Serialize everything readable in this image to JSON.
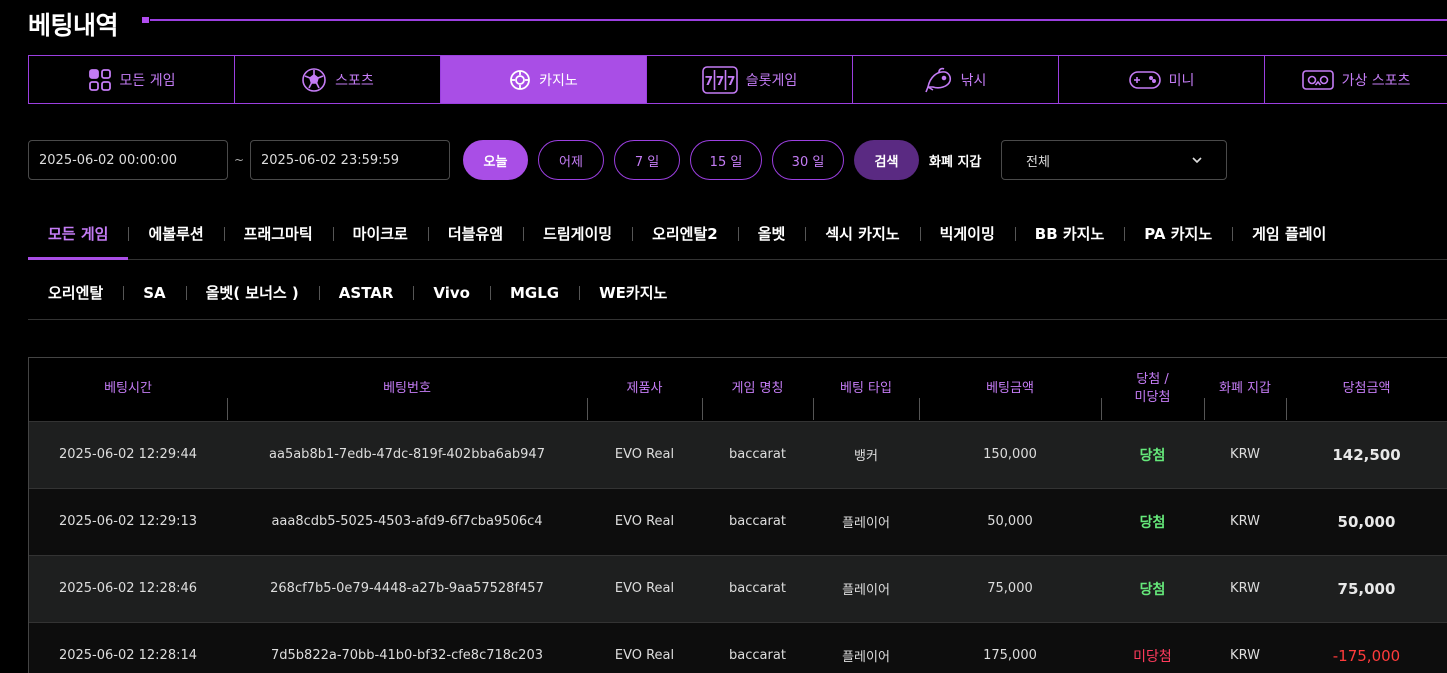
{
  "page": {
    "title": "베팅내역"
  },
  "categories": [
    {
      "label": "모든 게임",
      "icon": "grid-icon",
      "active": false
    },
    {
      "label": "스포츠",
      "icon": "soccer-ball-icon",
      "active": false
    },
    {
      "label": "카지노",
      "icon": "casino-chip-icon",
      "active": true
    },
    {
      "label": "슬롯게임",
      "icon": "slot-777-icon",
      "active": false
    },
    {
      "label": "낚시",
      "icon": "fish-icon",
      "active": false
    },
    {
      "label": "미니",
      "icon": "gamepad-icon",
      "active": false
    },
    {
      "label": "가상 스포츠",
      "icon": "vr-headset-icon",
      "active": false
    }
  ],
  "filter": {
    "start_date": "2025-06-02 00:00:00",
    "separator": "~",
    "end_date": "2025-06-02 23:59:59",
    "quick": [
      "오늘",
      "어제",
      "7 일",
      "15 일",
      "30 일"
    ],
    "active_quick": "오늘",
    "search_label": "검색",
    "wallet_label": "화폐 지갑",
    "wallet_value": "전체"
  },
  "providers_row1": [
    "모든 게임",
    "에볼루션",
    "프래그마틱",
    "마이크로",
    "더블유엠",
    "드림게이밍",
    "오리엔탈2",
    "올벳",
    "섹시 카지노",
    "빅게이밍",
    "BB 카지노",
    "PA 카지노",
    "게임 플레이"
  ],
  "providers_row2": [
    "오리엔탈",
    "SA",
    "올벳( 보너스 )",
    "ASTAR",
    "Vivo",
    "MGLG",
    "WE카지노"
  ],
  "active_provider": "모든 게임",
  "table": {
    "headers": [
      "베팅시간",
      "베팅번호",
      "제품사",
      "게임 명칭",
      "베팅 타입",
      "베팅금액",
      "당첨 /\n미당첨",
      "화폐 지갑",
      "당첨금액"
    ],
    "rows": [
      {
        "time": "2025-06-02 12:29:44",
        "bet_id": "aa5ab8b1-7edb-47dc-819f-402bba6ab947",
        "vendor": "EVO Real",
        "game": "baccarat",
        "type": "뱅커",
        "amount": "150,000",
        "result": "당첨",
        "win": true,
        "wallet": "KRW",
        "payout": "142,500"
      },
      {
        "time": "2025-06-02 12:29:13",
        "bet_id": "aaa8cdb5-5025-4503-afd9-6f7cba9506c4",
        "vendor": "EVO Real",
        "game": "baccarat",
        "type": "플레이어",
        "amount": "50,000",
        "result": "당첨",
        "win": true,
        "wallet": "KRW",
        "payout": "50,000"
      },
      {
        "time": "2025-06-02 12:28:46",
        "bet_id": "268cf7b5-0e79-4448-a27b-9aa57528f457",
        "vendor": "EVO Real",
        "game": "baccarat",
        "type": "플레이어",
        "amount": "75,000",
        "result": "당첨",
        "win": true,
        "wallet": "KRW",
        "payout": "75,000"
      },
      {
        "time": "2025-06-02 12:28:14",
        "bet_id": "7d5b822a-70bb-41b0-bf32-cfe8c718c203",
        "vendor": "EVO Real",
        "game": "baccarat",
        "type": "플레이어",
        "amount": "175,000",
        "result": "미당첨",
        "win": false,
        "wallet": "KRW",
        "payout": "-175,000"
      }
    ]
  },
  "colors": {
    "accent": "#a94ee6",
    "accent_text": "#c47cf5",
    "win": "#65e87a",
    "lose": "#ff3b5c"
  }
}
